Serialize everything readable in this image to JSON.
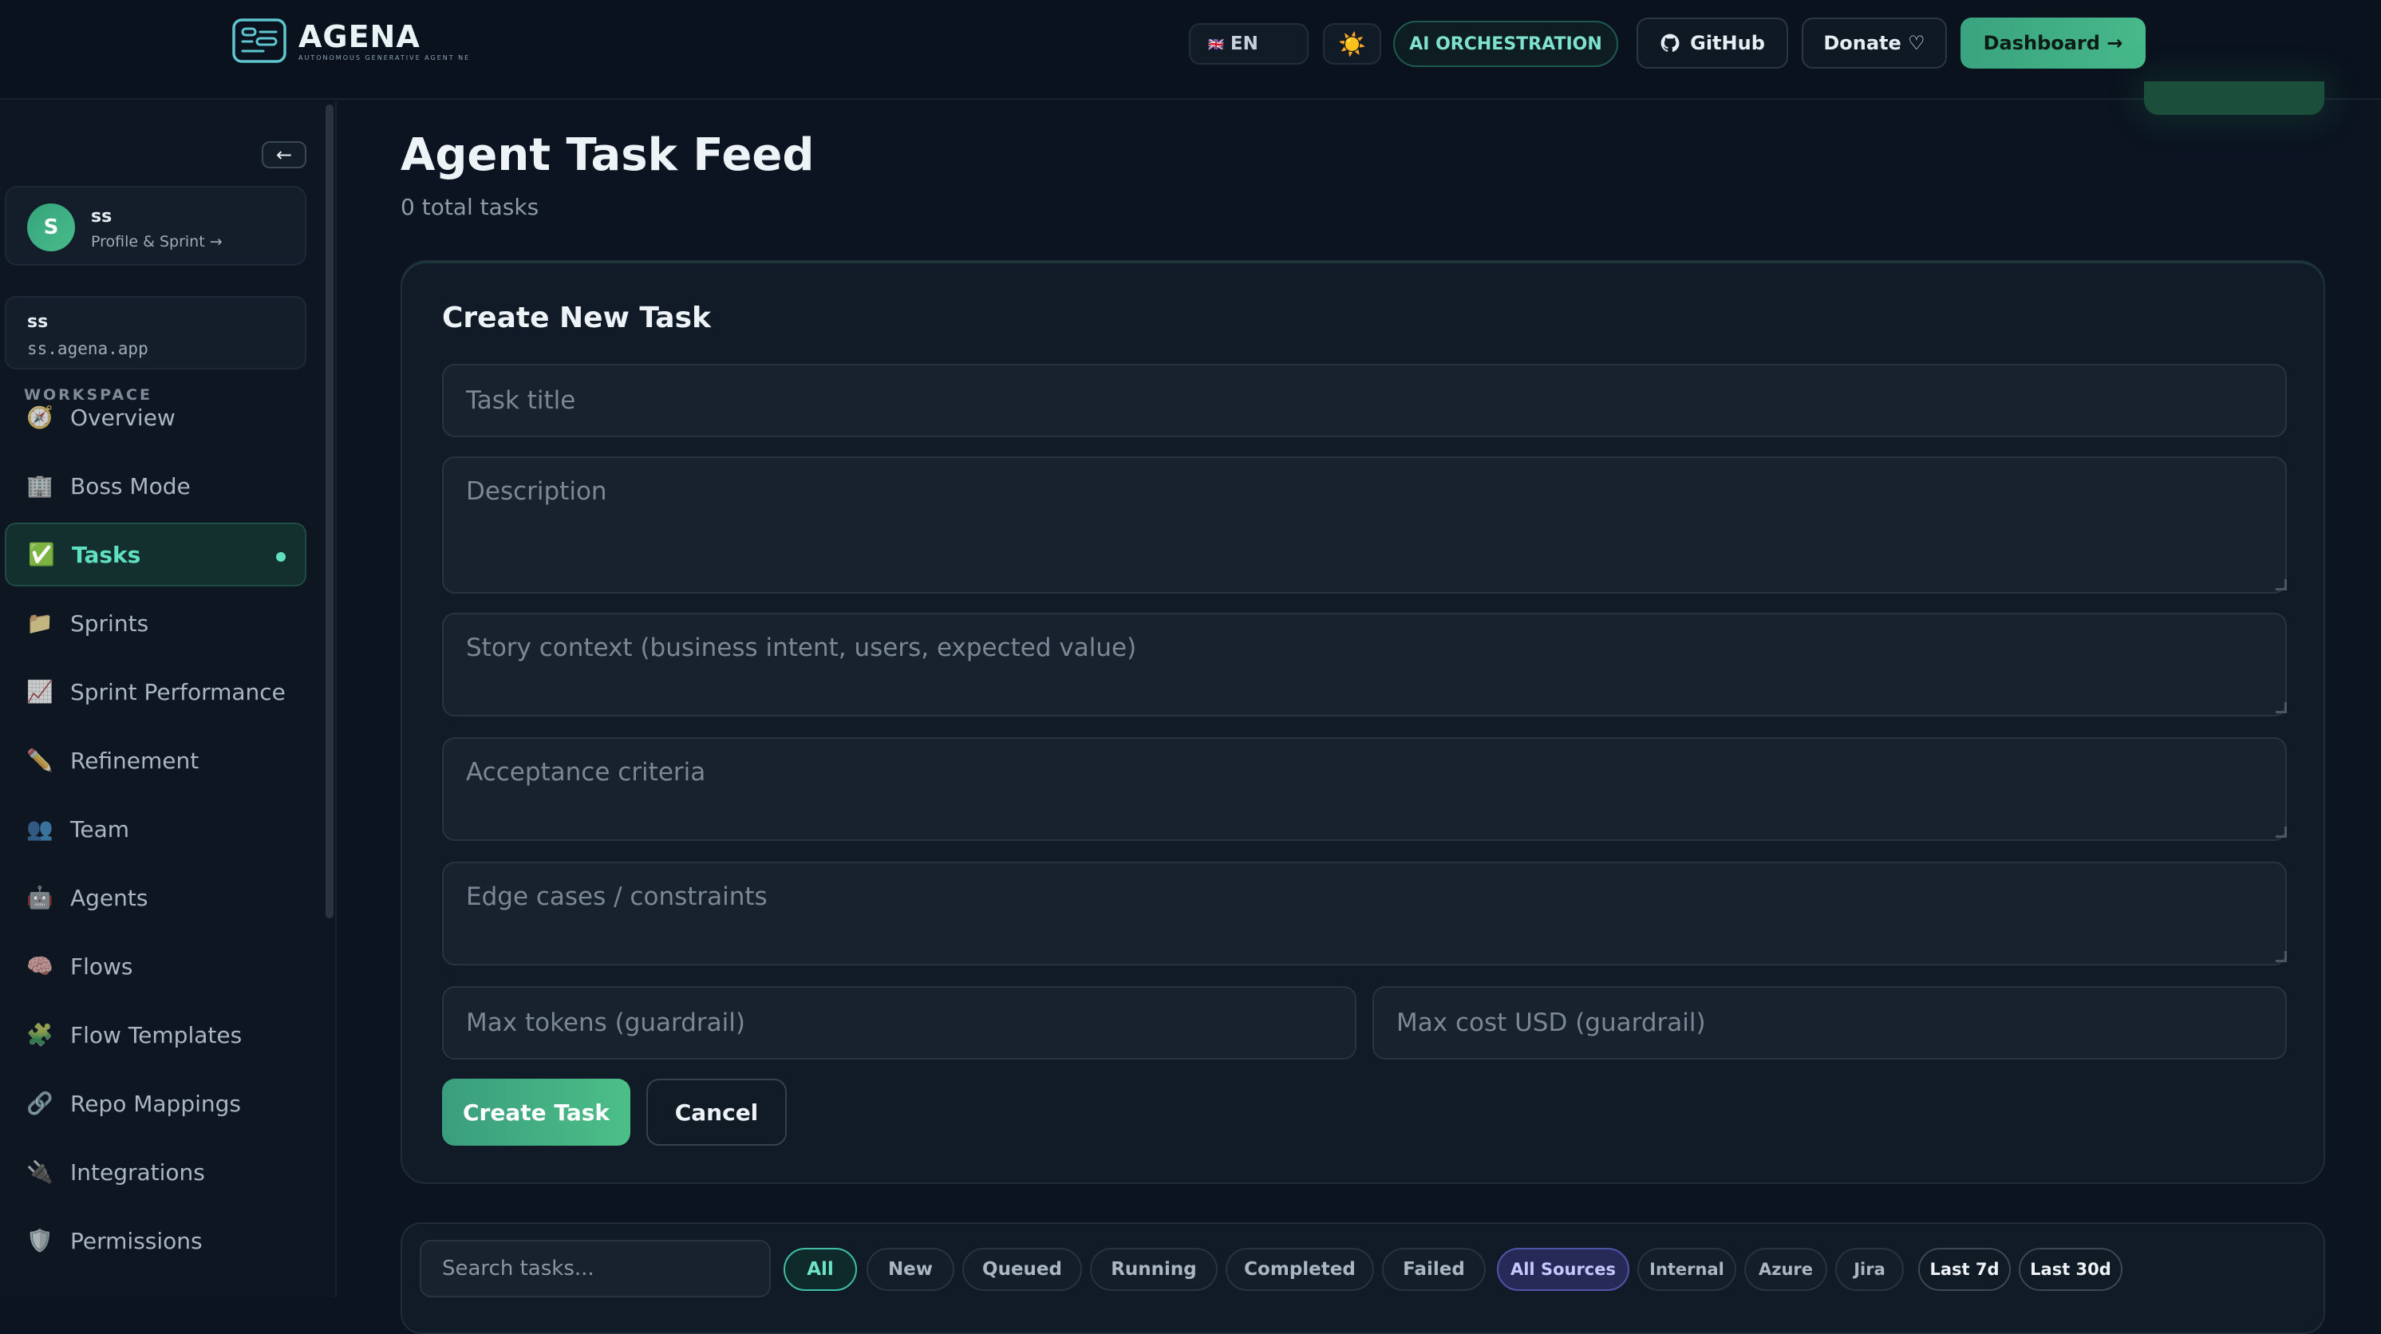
{
  "brand": {
    "name": "AGENA",
    "tagline": "AUTONOMOUS GENERATIVE AGENT NE"
  },
  "topbar": {
    "language": "EN",
    "theme_icon": "sun-icon",
    "orchestration_label": "AI ORCHESTRATION",
    "github_label": "GitHub",
    "donate_label": "Donate ♡",
    "dashboard_label": "Dashboard →"
  },
  "sidebar": {
    "collapse_icon": "←",
    "profile": {
      "initial": "S",
      "name": "ss",
      "link": "Profile & Sprint →"
    },
    "org": {
      "name": "ss",
      "domain": "ss.agena.app"
    },
    "section_label": "WORKSPACE",
    "items": [
      {
        "label": "Overview",
        "icon": "compass-icon",
        "glyph": "🧭"
      },
      {
        "label": "Boss Mode",
        "icon": "building-icon",
        "glyph": "🏢"
      },
      {
        "label": "Tasks",
        "icon": "check-icon",
        "glyph": "✅",
        "active": true
      },
      {
        "label": "Sprints",
        "icon": "folder-icon",
        "glyph": "📁"
      },
      {
        "label": "Sprint Performance",
        "icon": "chart-icon",
        "glyph": "📈"
      },
      {
        "label": "Refinement",
        "icon": "pencil-icon",
        "glyph": "✏️"
      },
      {
        "label": "Team",
        "icon": "people-icon",
        "glyph": "👥"
      },
      {
        "label": "Agents",
        "icon": "robot-icon",
        "glyph": "🤖"
      },
      {
        "label": "Flows",
        "icon": "brain-icon",
        "glyph": "🧠"
      },
      {
        "label": "Flow Templates",
        "icon": "puzzle-icon",
        "glyph": "🧩"
      },
      {
        "label": "Repo Mappings",
        "icon": "link-icon",
        "glyph": "🔗"
      },
      {
        "label": "Integrations",
        "icon": "plug-icon",
        "glyph": "🔌"
      },
      {
        "label": "Permissions",
        "icon": "shield-icon",
        "glyph": "🛡️"
      }
    ]
  },
  "main": {
    "title": "Agent Task Feed",
    "subtitle": "0 total tasks",
    "form": {
      "title": "Create New Task",
      "title_placeholder": "Task title",
      "description_placeholder": "Description",
      "story_placeholder": "Story context (business intent, users, expected value)",
      "acceptance_placeholder": "Acceptance criteria",
      "edge_placeholder": "Edge cases / constraints",
      "max_tokens_placeholder": "Max tokens (guardrail)",
      "max_cost_placeholder": "Max cost USD (guardrail)",
      "create_label": "Create Task",
      "cancel_label": "Cancel"
    },
    "filters": {
      "search_placeholder": "Search tasks...",
      "status": [
        "All",
        "New",
        "Queued",
        "Running",
        "Completed",
        "Failed"
      ],
      "sources": [
        "All Sources",
        "Internal",
        "Azure",
        "Jira"
      ],
      "time": [
        "Last 7d",
        "Last 30d"
      ]
    }
  },
  "colors": {
    "accent": "#4cbf87",
    "active_text": "#5fe0c1",
    "source_active": "#272a56"
  }
}
